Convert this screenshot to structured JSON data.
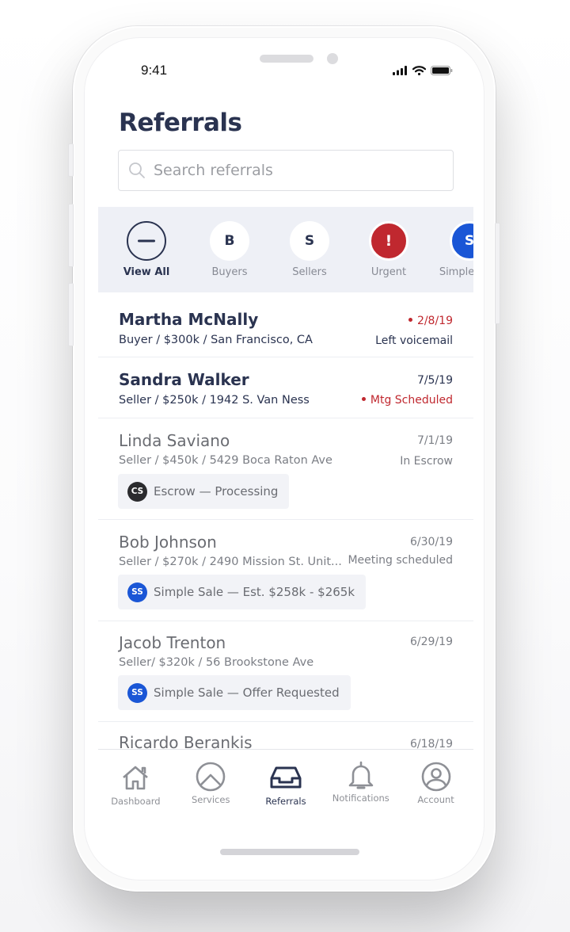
{
  "status_bar": {
    "time": "9:41",
    "icons": [
      "signal-icon",
      "wifi-icon",
      "battery-icon"
    ]
  },
  "header": {
    "title": "Referrals"
  },
  "search": {
    "placeholder": "Search referrals",
    "value": ""
  },
  "filters": [
    {
      "label": "View All",
      "glyph": "—",
      "icon": "minus-circle-icon",
      "active": true
    },
    {
      "label": "Buyers",
      "glyph": "B",
      "icon": "buyers-icon",
      "active": false
    },
    {
      "label": "Sellers",
      "glyph": "S",
      "icon": "sellers-icon",
      "active": false
    },
    {
      "label": "Urgent",
      "glyph": "!",
      "icon": "urgent-icon",
      "active": false,
      "color": "#c0282f"
    },
    {
      "label": "Simple Sale",
      "glyph": "S",
      "icon": "simple-sale-icon",
      "active": false,
      "color": "#1a56d6"
    }
  ],
  "referrals": [
    {
      "name": "Martha McNally",
      "details": "Buyer / $300k / San Francisco, CA",
      "date": "2/8/19",
      "status": "Left voicemail",
      "date_urgent": true,
      "status_urgent": false,
      "emphasis": true
    },
    {
      "name": "Sandra Walker",
      "details": "Seller / $250k / 1942 S. Van Ness",
      "date": "7/5/19",
      "status": "Mtg Scheduled",
      "date_urgent": false,
      "status_urgent": true,
      "emphasis": true
    },
    {
      "name": "Linda Saviano",
      "details": "Seller / $450k / 5429 Boca Raton Ave",
      "date": "7/1/19",
      "status": "In Escrow",
      "emphasis": false,
      "chip": {
        "badge": "CS",
        "text": "Escrow — Processing",
        "color": "#2b2b2e"
      }
    },
    {
      "name": "Bob Johnson",
      "details": "Seller / $270k / 2490 Mission St. Unit...",
      "date": "6/30/19",
      "status": "Meeting scheduled",
      "emphasis": false,
      "chip": {
        "badge": "SS",
        "text": "Simple Sale — Est. $258k - $265k",
        "color": "#1a56d6"
      }
    },
    {
      "name": "Jacob Trenton",
      "details": "Seller/ $320k / 56 Brookstone Ave",
      "date": "6/29/19",
      "status": "",
      "emphasis": false,
      "chip": {
        "badge": "SS",
        "text": "Simple Sale — Offer Requested",
        "color": "#1a56d6"
      }
    },
    {
      "name": "Ricardo Berankis",
      "details": "",
      "date": "6/18/19",
      "status": "",
      "emphasis": false
    }
  ],
  "tabbar": [
    {
      "label": "Dashboard",
      "icon": "home-icon",
      "active": false
    },
    {
      "label": "Services",
      "icon": "services-icon",
      "active": false
    },
    {
      "label": "Referrals",
      "icon": "inbox-tray-icon",
      "active": true
    },
    {
      "label": "Notifications",
      "icon": "bell-icon",
      "active": false
    },
    {
      "label": "Account",
      "icon": "account-icon",
      "active": false
    }
  ],
  "colors": {
    "primary": "#2a3350",
    "urgent": "#c0282f",
    "simple_sale": "#1a56d6",
    "escrow": "#2b2b2e",
    "filter_bg": "#eef0f6"
  }
}
